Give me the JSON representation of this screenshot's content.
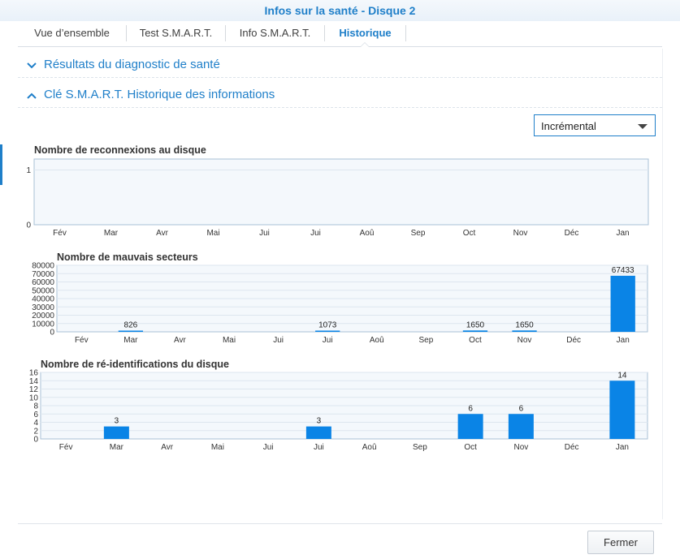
{
  "window": {
    "title": "Infos sur la santé - Disque 2"
  },
  "tabs": [
    {
      "label": "Vue d’ensemble",
      "active": false
    },
    {
      "label": "Test S.M.A.R.T.",
      "active": false
    },
    {
      "label": "Info S.M.A.R.T.",
      "active": false
    },
    {
      "label": "Historique",
      "active": true
    }
  ],
  "sections": [
    {
      "label": "Résultats du diagnostic de santé",
      "expanded": false
    },
    {
      "label": "Clé S.M.A.R.T. Historique des informations",
      "expanded": true
    }
  ],
  "mode_select": {
    "value": "Incrémental"
  },
  "colors": {
    "accent": "#1f7fc9",
    "bar": "#0a84e6"
  },
  "chart_data": [
    {
      "type": "bar",
      "title": "Nombre de reconnexions au disque",
      "categories": [
        "Fév",
        "Mar",
        "Avr",
        "Mai",
        "Jui",
        "Jui",
        "Aoû",
        "Sep",
        "Oct",
        "Nov",
        "Déc",
        "Jan"
      ],
      "values": [
        0,
        0,
        0,
        0,
        0,
        0,
        0,
        0,
        0,
        0,
        0,
        0
      ],
      "yticks": [
        0,
        1
      ],
      "ylim": [
        0,
        1.2
      ],
      "data_labels": false,
      "grid": true
    },
    {
      "type": "bar",
      "title": "Nombre de mauvais secteurs",
      "categories": [
        "Fév",
        "Mar",
        "Avr",
        "Mai",
        "Jui",
        "Jui",
        "Aoû",
        "Sep",
        "Oct",
        "Nov",
        "Déc",
        "Jan"
      ],
      "values": [
        0,
        826,
        0,
        0,
        0,
        1073,
        0,
        0,
        1650,
        1650,
        0,
        67433
      ],
      "yticks": [
        0,
        10000,
        20000,
        30000,
        40000,
        50000,
        60000,
        70000,
        80000
      ],
      "ylim": [
        0,
        80000
      ],
      "data_labels": true,
      "grid": true
    },
    {
      "type": "bar",
      "title": "Nombre de ré-identifications du disque",
      "categories": [
        "Fév",
        "Mar",
        "Avr",
        "Mai",
        "Jui",
        "Jui",
        "Aoû",
        "Sep",
        "Oct",
        "Nov",
        "Déc",
        "Jan"
      ],
      "values": [
        0,
        3,
        0,
        0,
        0,
        3,
        0,
        0,
        6,
        6,
        0,
        14
      ],
      "yticks": [
        0,
        2,
        4,
        6,
        8,
        10,
        12,
        14,
        16
      ],
      "ylim": [
        0,
        16
      ],
      "data_labels": true,
      "grid": true
    }
  ],
  "footer": {
    "close_label": "Fermer"
  }
}
